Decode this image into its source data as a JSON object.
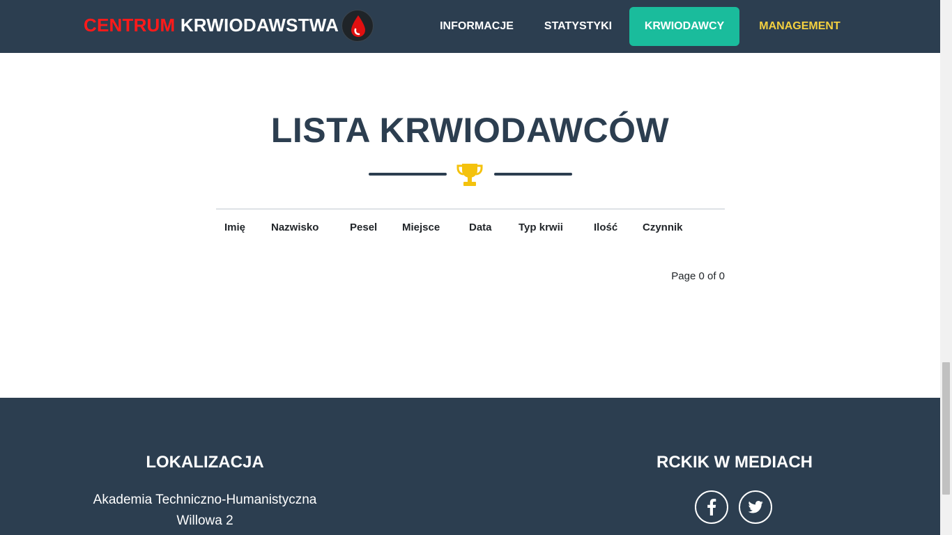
{
  "header": {
    "brand_part1": "CENTRUM",
    "brand_part2": "KRWIODAWSTWA",
    "logo_icon": "blood-drop-icon",
    "nav": [
      {
        "label": "INFORMACJE",
        "active": false
      },
      {
        "label": "STATYSTYKI",
        "active": false
      },
      {
        "label": "KRWIODAWCY",
        "active": true
      },
      {
        "label": "MANAGEMENT",
        "active": false
      }
    ]
  },
  "main": {
    "title": "LISTA KRWIODAWCÓW",
    "divider_icon": "trophy-icon",
    "table": {
      "columns": [
        "Imię",
        "Nazwisko",
        "Pesel",
        "Miejsce",
        "Data",
        "Typ krwii",
        "Ilość",
        "Czynnik"
      ],
      "rows": []
    },
    "pagination": "Page 0 of 0"
  },
  "footer": {
    "location_title": "LOKALIZACJA",
    "address_line1": "Akademia Techniczno-Humanistyczna",
    "address_line2": "Willowa 2",
    "media_title": "RCKIK W MEDIACH",
    "social_icons": [
      "facebook-icon",
      "twitter-icon"
    ]
  },
  "colors": {
    "navbar_bg": "#2c3e50",
    "brand_red": "#ff1a1a",
    "active_tab": "#1abc9c",
    "management_yellow": "#f4d03f",
    "trophy_gold": "#f4c20d",
    "footer_bg": "#2c3e50"
  }
}
